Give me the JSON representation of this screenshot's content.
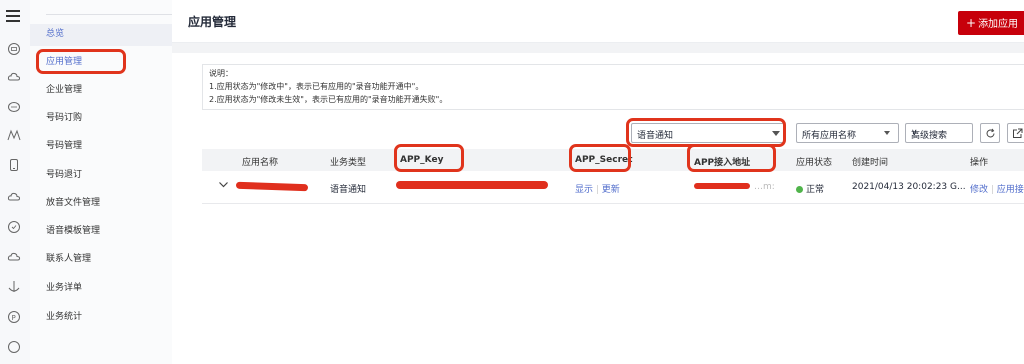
{
  "sidebar": {
    "items": [
      {
        "label": "总览"
      },
      {
        "label": "应用管理"
      },
      {
        "label": "企业管理"
      },
      {
        "label": "号码订购"
      },
      {
        "label": "号码管理"
      },
      {
        "label": "号码退订"
      },
      {
        "label": "放音文件管理"
      },
      {
        "label": "语音模板管理"
      },
      {
        "label": "联系人管理"
      },
      {
        "label": "业务详单"
      },
      {
        "label": "业务统计"
      }
    ]
  },
  "header": {
    "title": "应用管理",
    "add_button": "添加应用"
  },
  "note": {
    "heading": "说明：",
    "line1": "1.应用状态为\"修改中\"，表示已有应用的\"录音功能开通中\"。",
    "line2": "2.应用状态为\"修改未生效\"，表示已有应用的\"录音功能开通失败\"。"
  },
  "filters": {
    "business_type_selected": "语音通知",
    "app_name_selected": "所有应用名称",
    "advanced_search": "高级搜索"
  },
  "table": {
    "columns": [
      "应用名称",
      "业务类型",
      "APP_Key",
      "APP_Secret",
      "APP接入地址",
      "应用状态",
      "创建时间",
      "操作"
    ],
    "rows": [
      {
        "business_type": "语音通知",
        "secret_show": "显示",
        "secret_update": "更新",
        "address_partial": "…m:",
        "status": "正常",
        "created": "2021/04/13 20:02:23 G...",
        "op_modify": "修改",
        "op_more": "应用接"
      }
    ]
  },
  "colors": {
    "accent": "#526ecc",
    "brand_red": "#c7000b",
    "annotation_red": "#e0341c",
    "status_ok": "#50b44b"
  }
}
